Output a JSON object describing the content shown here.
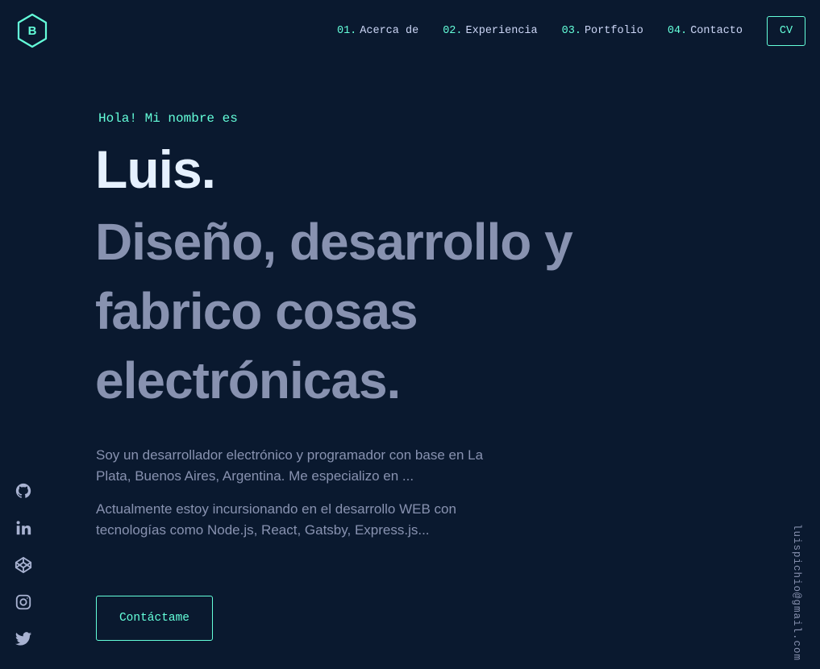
{
  "header": {
    "logo_letter": "B",
    "nav": [
      {
        "num": "01.",
        "label": "Acerca de"
      },
      {
        "num": "02.",
        "label": "Experiencia"
      },
      {
        "num": "03.",
        "label": "Portfolio"
      },
      {
        "num": "04.",
        "label": "Contacto"
      }
    ],
    "cv_label": "CV"
  },
  "hero": {
    "greeting": "Hola! Mi nombre es",
    "name": "Luis.",
    "tagline": "Diseño, desarrollo y fabrico cosas electrónicas.",
    "paragraphs": [
      "Soy un desarrollador electrónico y programador con base en La Plata, Buenos Aires, Argentina. Me especializo en ...",
      "Actualmente estoy incursionando en el desarrollo WEB con tecnologías como Node.js, React, Gatsby, Express.js..."
    ],
    "cta_label": "Contáctame"
  },
  "social": [
    {
      "icon": "github-icon"
    },
    {
      "icon": "linkedin-icon"
    },
    {
      "icon": "codepen-icon"
    },
    {
      "icon": "instagram-icon"
    },
    {
      "icon": "twitter-icon"
    }
  ],
  "email": "luispichio@gmail.com",
  "colors": {
    "background": "#0a192f",
    "accent": "#64ffda",
    "heading": "#e6f1ff",
    "text": "#8892b0",
    "nav_text": "#ccd6f6"
  }
}
